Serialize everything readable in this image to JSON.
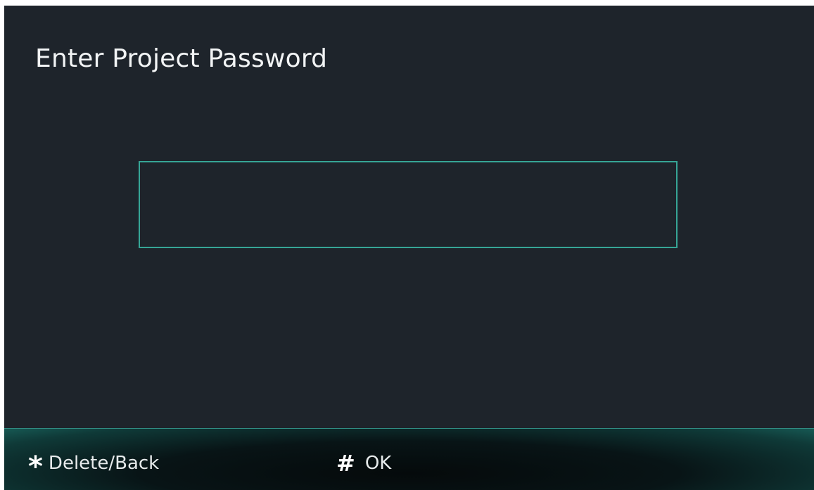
{
  "screen": {
    "title": "Enter Project Password"
  },
  "password_field": {
    "value": "",
    "placeholder": ""
  },
  "softkeys": [
    {
      "key": "*",
      "icon": "asterisk-icon",
      "label": "Delete/Back"
    },
    {
      "key": "#",
      "icon": "hash-icon",
      "label": "OK"
    }
  ],
  "colors": {
    "background": "#1e242b",
    "accent": "#36a596",
    "text": "#f2f4f5"
  }
}
